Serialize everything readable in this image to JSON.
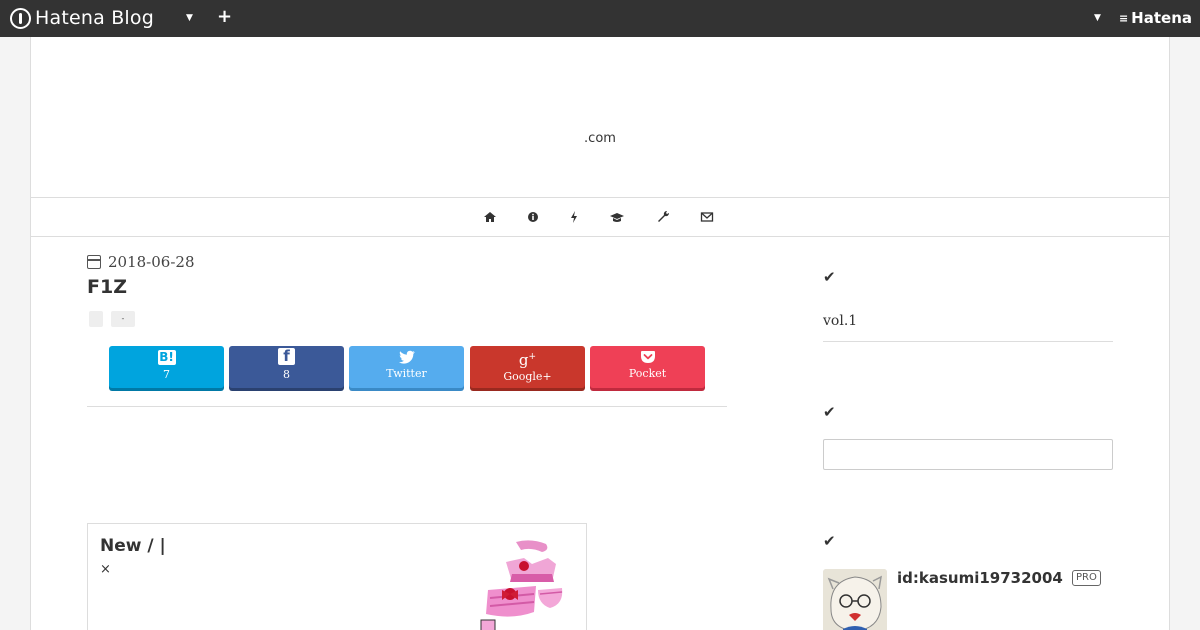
{
  "topbar": {
    "logo_text": "Hatena Blog",
    "brand_text": "Hatena",
    "colors": {
      "bar": "#333333"
    }
  },
  "blog": {
    "title": ".com",
    "nav_icons": [
      "home-icon",
      "info-icon",
      "bolt-icon",
      "graduation-cap-icon",
      "wrench-icon",
      "envelope-icon"
    ]
  },
  "entry": {
    "date": "2018-06-28",
    "title": "F1Z",
    "categories": [
      "",
      "-"
    ]
  },
  "share": {
    "hatebu": {
      "icon": "B!",
      "label": "7",
      "color": "#00a4de"
    },
    "facebook": {
      "icon": "f",
      "label": "8",
      "color": "#3b5998"
    },
    "twitter": {
      "icon": "twitter",
      "label": "Twitter",
      "color": "#55acee"
    },
    "googleplus": {
      "icon": "g+",
      "label": "Google+",
      "color": "#db4437"
    },
    "pocket": {
      "icon": "pocket",
      "label": "Pocket",
      "color": "#ef4056"
    }
  },
  "card": {
    "title": "New / |",
    "subtitle": "×"
  },
  "sidebar": {
    "section1_text": "vol.1",
    "search_placeholder": "",
    "profile_id": "id:kasumi19732004",
    "badge": "PRO"
  }
}
